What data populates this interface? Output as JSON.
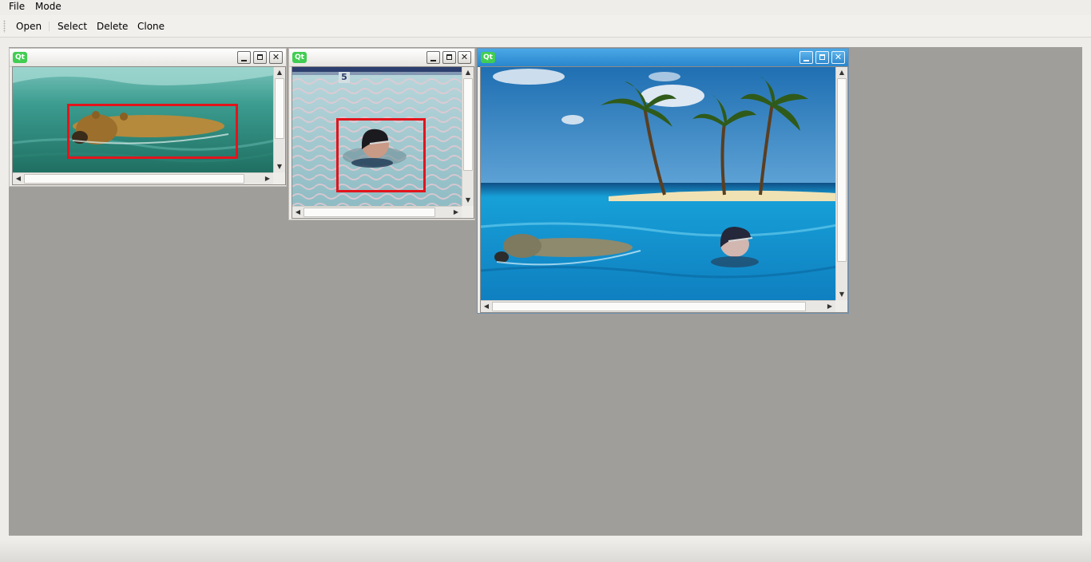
{
  "menubar": {
    "file": "File",
    "mode": "Mode"
  },
  "toolbar": {
    "open": "Open",
    "select": "Select",
    "delete": "Delete",
    "clone": "Clone"
  },
  "windows": [
    {
      "icon_text": "Qt",
      "image": "bear-swimming",
      "selection": "bear",
      "active": false
    },
    {
      "icon_text": "Qt",
      "image": "woman-swimming",
      "lane_number": "5",
      "selection": "swimmer-head",
      "active": false
    },
    {
      "icon_text": "Qt",
      "image": "island-composite",
      "active": true
    }
  ],
  "colors": {
    "selection": "#e3141c",
    "mdi_background": "#a09e9a",
    "active_title": "#2a86cd",
    "qt_green": "#41cd52"
  }
}
